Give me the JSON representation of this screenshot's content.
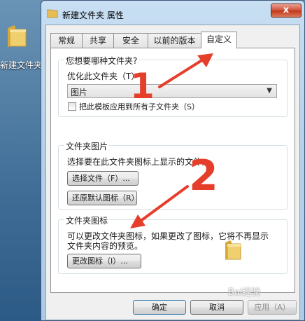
{
  "desktop": {
    "icon_label": "新建文件夹"
  },
  "window": {
    "title": "新建文件夹 属性",
    "close_label": "x"
  },
  "tabs": [
    {
      "label": "常规",
      "active": false
    },
    {
      "label": "共享",
      "active": false
    },
    {
      "label": "安全",
      "active": false
    },
    {
      "label": "以前的版本",
      "active": false
    },
    {
      "label": "自定义",
      "active": true
    }
  ],
  "optimize_group": {
    "title": "您想要哪种文件夹?",
    "optimize_label": "优化此文件夹（T）:",
    "optimize_value": "图片",
    "apply_template_label": "把此模板应用到所有子文件夹（S）",
    "apply_template_checked": false
  },
  "folder_pictures_group": {
    "title": "文件夹图片",
    "description": "选择要在此文件夹图标上显示的文件。",
    "choose_file_button": "选择文件（F）...",
    "restore_default_button": "还原默认图标（R）"
  },
  "folder_icon_group": {
    "title": "文件夹图标",
    "description_line1": "可以更改文件夹图标，如果更改了图标，它将不再显示",
    "description_line2": "文件夹内容的预览。",
    "change_icon_button": "更改图标（I）..."
  },
  "footer": {
    "ok_button": "确定",
    "cancel_button": "取消",
    "apply_button": "应用（A）"
  },
  "annotations": {
    "step1": "1",
    "step2": "2"
  },
  "watermark": "Bai经验",
  "colors": {
    "annotation": "#e53e2a",
    "close_button": "#c5391d",
    "folder": "#e8c25a"
  }
}
